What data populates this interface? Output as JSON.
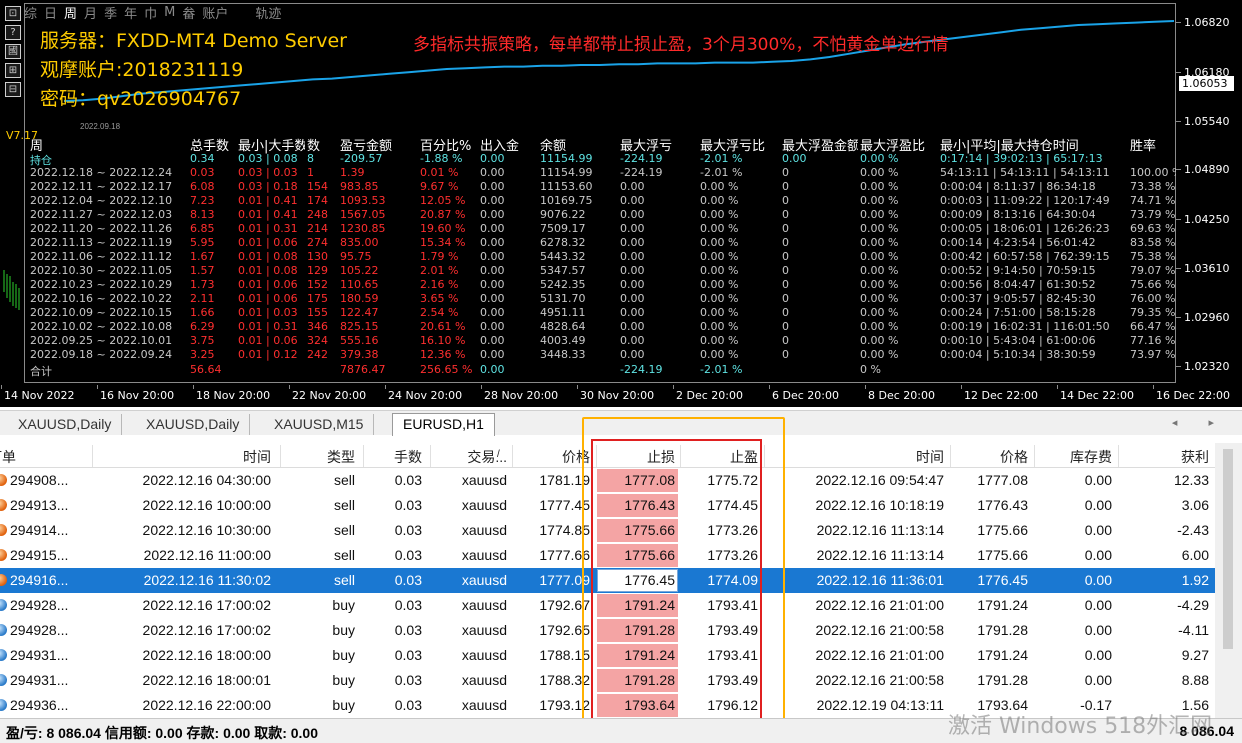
{
  "period_bar": [
    {
      "label": "综",
      "active": false
    },
    {
      "label": "日",
      "active": false
    },
    {
      "label": "周",
      "active": true
    },
    {
      "label": "月",
      "active": false
    },
    {
      "label": "季",
      "active": false
    },
    {
      "label": "年",
      "active": false
    },
    {
      "label": "巾",
      "active": false
    },
    {
      "label": "M",
      "active": false
    },
    {
      "label": "畚",
      "active": false
    },
    {
      "label": "账户",
      "active": false
    },
    {
      "label": "轨迹",
      "active": false,
      "wide": true
    }
  ],
  "left_tools": [
    "⊡",
    "?",
    "國",
    "⊞",
    "⊟"
  ],
  "left_vertical": "V7.17",
  "info": {
    "server": "服务器：FXDD-MT4 Demo Server",
    "account": "观摩账户:2018231119",
    "password": "密码：qv2026904767"
  },
  "headline": "多指标共振策略，每单都带止损止盈，3个月300%，不怕黄金单边行情",
  "start_date": "2022.09.18",
  "equity_curve": [
    0.0,
    0.01,
    0.03,
    0.06,
    0.09,
    0.11,
    0.13,
    0.15,
    0.17,
    0.19,
    0.21,
    0.23,
    0.25,
    0.27,
    0.28,
    0.3,
    0.32,
    0.34,
    0.36,
    0.38,
    0.4,
    0.41,
    0.42,
    0.43,
    0.43,
    0.44,
    0.44,
    0.45,
    0.45,
    0.46,
    0.46,
    0.47,
    0.47,
    0.47,
    0.48,
    0.48,
    0.48,
    0.49,
    0.5,
    0.52,
    0.55,
    0.59,
    0.63,
    0.67,
    0.71,
    0.74,
    0.77,
    0.8,
    0.83,
    0.86,
    0.89,
    0.91,
    0.93,
    0.95,
    0.96,
    0.97,
    0.98,
    0.99,
    1.0
  ],
  "stats": {
    "headers": [
      "周",
      "总手数",
      "最小|大手数",
      "数",
      "盈亏金额",
      "百分比%",
      "出入金",
      "余额",
      "最大浮亏",
      "最大浮亏比",
      "最大浮盈金额",
      "最大浮盈比",
      "最小|平均|最大持仓时间",
      "胜率"
    ],
    "holding": [
      "持仓",
      "0.34",
      "0.03 | 0.08",
      "8",
      "-209.57",
      "-1.88 %",
      "0.00",
      "11154.99",
      "-224.19",
      "-2.01 %",
      "0.00",
      "0.00 %",
      "0:17:14 | 39:02:13 | 65:17:13",
      ""
    ],
    "weeks": [
      [
        "2022.12.18 ~ 2022.12.24",
        "0.03",
        "0.03 | 0.03",
        "1",
        "1.39",
        "0.01 %",
        "0.00",
        "11154.99",
        "-224.19",
        "-2.01 %",
        "0",
        "0.00 %",
        "54:13:11 | 54:13:11 | 54:13:11",
        "100.00 %"
      ],
      [
        "2022.12.11 ~ 2022.12.17",
        "6.08",
        "0.03 | 0.18",
        "154",
        "983.85",
        "9.67 %",
        "0.00",
        "11153.60",
        "0.00",
        "0.00 %",
        "0",
        "0.00 %",
        "0:00:04 | 8:11:37 | 86:34:18",
        "73.38 %"
      ],
      [
        "2022.12.04 ~ 2022.12.10",
        "7.23",
        "0.01 | 0.41",
        "174",
        "1093.53",
        "12.05 %",
        "0.00",
        "10169.75",
        "0.00",
        "0.00 %",
        "0",
        "0.00 %",
        "0:00:03 | 11:09:22 | 120:17:49",
        "74.71 %"
      ],
      [
        "2022.11.27 ~ 2022.12.03",
        "8.13",
        "0.01 | 0.41",
        "248",
        "1567.05",
        "20.87 %",
        "0.00",
        "9076.22",
        "0.00",
        "0.00 %",
        "0",
        "0.00 %",
        "0:00:09 | 8:13:16 | 64:30:04",
        "73.79 %"
      ],
      [
        "2022.11.20 ~ 2022.11.26",
        "6.85",
        "0.01 | 0.31",
        "214",
        "1230.85",
        "19.60 %",
        "0.00",
        "7509.17",
        "0.00",
        "0.00 %",
        "0",
        "0.00 %",
        "0:00:05 | 18:06:01 | 126:26:23",
        "69.63 %"
      ],
      [
        "2022.11.13 ~ 2022.11.19",
        "5.95",
        "0.01 | 0.06",
        "274",
        "835.00",
        "15.34 %",
        "0.00",
        "6278.32",
        "0.00",
        "0.00 %",
        "0",
        "0.00 %",
        "0:00:14 | 4:23:54 | 56:01:42",
        "83.58 %"
      ],
      [
        "2022.11.06 ~ 2022.11.12",
        "1.67",
        "0.01 | 0.08",
        "130",
        "95.75",
        "1.79 %",
        "0.00",
        "5443.32",
        "0.00",
        "0.00 %",
        "0",
        "0.00 %",
        "0:00:42 | 60:57:58 | 762:39:15",
        "75.38 %"
      ],
      [
        "2022.10.30 ~ 2022.11.05",
        "1.57",
        "0.01 | 0.08",
        "129",
        "105.22",
        "2.01 %",
        "0.00",
        "5347.57",
        "0.00",
        "0.00 %",
        "0",
        "0.00 %",
        "0:00:52 | 9:14:50 | 70:59:15",
        "79.07 %"
      ],
      [
        "2022.10.23 ~ 2022.10.29",
        "1.73",
        "0.01 | 0.06",
        "152",
        "110.65",
        "2.16 %",
        "0.00",
        "5242.35",
        "0.00",
        "0.00 %",
        "0",
        "0.00 %",
        "0:00:56 | 8:04:47 | 61:30:52",
        "75.66 %"
      ],
      [
        "2022.10.16 ~ 2022.10.22",
        "2.11",
        "0.01 | 0.06",
        "175",
        "180.59",
        "3.65 %",
        "0.00",
        "5131.70",
        "0.00",
        "0.00 %",
        "0",
        "0.00 %",
        "0:00:37 | 9:05:57 | 82:45:30",
        "76.00 %"
      ],
      [
        "2022.10.09 ~ 2022.10.15",
        "1.66",
        "0.01 | 0.03",
        "155",
        "122.47",
        "2.54 %",
        "0.00",
        "4951.11",
        "0.00",
        "0.00 %",
        "0",
        "0.00 %",
        "0:00:24 | 7:51:00 | 58:15:28",
        "79.35 %"
      ],
      [
        "2022.10.02 ~ 2022.10.08",
        "6.29",
        "0.01 | 0.31",
        "346",
        "825.15",
        "20.61 %",
        "0.00",
        "4828.64",
        "0.00",
        "0.00 %",
        "0",
        "0.00 %",
        "0:00:19 | 16:02:31 | 116:01:50",
        "66.47 %"
      ],
      [
        "2022.09.25 ~ 2022.10.01",
        "3.75",
        "0.01 | 0.06",
        "324",
        "555.16",
        "16.10 %",
        "0.00",
        "4003.49",
        "0.00",
        "0.00 %",
        "0",
        "0.00 %",
        "0:00:10 | 5:43:04 | 61:00:06",
        "77.16 %"
      ],
      [
        "2022.09.18 ~ 2022.09.24",
        "3.25",
        "0.01 | 0.12",
        "242",
        "379.38",
        "12.36 %",
        "0.00",
        "3448.33",
        "0.00",
        "0.00 %",
        "0",
        "0.00 %",
        "0:00:04 | 5:10:34 | 38:30:59",
        "73.97 %"
      ]
    ],
    "total": [
      "合计",
      "56.64",
      "",
      "",
      "7876.47",
      "256.65 %",
      "0.00",
      "",
      "-224.19",
      "-2.01 %",
      "",
      "0 %",
      "",
      ""
    ]
  },
  "price_axis": [
    "1.06820",
    "1.06180",
    "1.05540",
    "1.04890",
    "1.04250",
    "1.03610",
    "1.02960",
    "1.02320"
  ],
  "current_price": "1.06053",
  "time_axis": [
    "14 Nov 2022",
    "16 Nov 20:00",
    "18 Nov 20:00",
    "22 Nov 20:00",
    "24 Nov 20:00",
    "28 Nov 20:00",
    "30 Nov 20:00",
    "2 Dec 20:00",
    "6 Dec 20:00",
    "8 Dec 20:00",
    "12 Dec 22:00",
    "14 Dec 22:00",
    "16 Dec 22:00"
  ],
  "tabs": [
    {
      "label": "XAUUSD,Daily",
      "active": false
    },
    {
      "label": "XAUUSD,Daily",
      "active": false
    },
    {
      "label": "XAUUSD,M15",
      "active": false
    },
    {
      "label": "EURUSD,H1",
      "active": true
    }
  ],
  "tab_arrows": "◂ ▸",
  "grid": {
    "headers": [
      "订单",
      "时间",
      "类型",
      "手数",
      "交易...",
      "价格",
      "止损",
      "止盈",
      "时间",
      "价格",
      "库存费",
      "获利"
    ],
    "sort_mark": "/",
    "rows": [
      {
        "type_icon": "sell",
        "cells": [
          "294908...",
          "2022.12.16 04:30:00",
          "sell",
          "0.03",
          "xauusd",
          "1781.19",
          "1777.08",
          "1775.72",
          "2022.12.16 09:54:47",
          "1777.08",
          "0.00",
          "12.33"
        ]
      },
      {
        "type_icon": "sell",
        "cells": [
          "294913...",
          "2022.12.16 10:00:00",
          "sell",
          "0.03",
          "xauusd",
          "1777.45",
          "1776.43",
          "1774.45",
          "2022.12.16 10:18:19",
          "1776.43",
          "0.00",
          "3.06"
        ]
      },
      {
        "type_icon": "sell",
        "cells": [
          "294914...",
          "2022.12.16 10:30:00",
          "sell",
          "0.03",
          "xauusd",
          "1774.85",
          "1775.66",
          "1773.26",
          "2022.12.16 11:13:14",
          "1775.66",
          "0.00",
          "-2.43"
        ]
      },
      {
        "type_icon": "sell",
        "cells": [
          "294915...",
          "2022.12.16 11:00:00",
          "sell",
          "0.03",
          "xauusd",
          "1777.66",
          "1775.66",
          "1773.26",
          "2022.12.16 11:13:14",
          "1775.66",
          "0.00",
          "6.00"
        ]
      },
      {
        "type_icon": "sell",
        "selected": true,
        "cells": [
          "294916...",
          "2022.12.16 11:30:02",
          "sell",
          "0.03",
          "xauusd",
          "1777.09",
          "1776.45",
          "1774.09",
          "2022.12.16 11:36:01",
          "1776.45",
          "0.00",
          "1.92"
        ]
      },
      {
        "type_icon": "buy",
        "cells": [
          "294928...",
          "2022.12.16 17:00:02",
          "buy",
          "0.03",
          "xauusd",
          "1792.67",
          "1791.24",
          "1793.41",
          "2022.12.16 21:01:00",
          "1791.24",
          "0.00",
          "-4.29"
        ]
      },
      {
        "type_icon": "buy",
        "cells": [
          "294928...",
          "2022.12.16 17:00:02",
          "buy",
          "0.03",
          "xauusd",
          "1792.65",
          "1791.28",
          "1793.49",
          "2022.12.16 21:00:58",
          "1791.28",
          "0.00",
          "-4.11"
        ]
      },
      {
        "type_icon": "buy",
        "cells": [
          "294931...",
          "2022.12.16 18:00:00",
          "buy",
          "0.03",
          "xauusd",
          "1788.15",
          "1791.24",
          "1793.41",
          "2022.12.16 21:01:00",
          "1791.24",
          "0.00",
          "9.27"
        ]
      },
      {
        "type_icon": "buy",
        "cells": [
          "294931...",
          "2022.12.16 18:00:01",
          "buy",
          "0.03",
          "xauusd",
          "1788.32",
          "1791.28",
          "1793.49",
          "2022.12.16 21:00:58",
          "1791.28",
          "0.00",
          "8.88"
        ]
      },
      {
        "type_icon": "buy",
        "cells": [
          "294936...",
          "2022.12.16 22:00:00",
          "buy",
          "0.03",
          "xauusd",
          "1793.12",
          "1793.64",
          "1796.12",
          "2022.12.19 04:13:11",
          "1793.64",
          "-0.17",
          "1.56"
        ]
      }
    ]
  },
  "status": {
    "text": "盈/亏: 8 086.04  信用额: 0.00  存款: 0.00  取款: 0.00",
    "total": "8 086.04"
  },
  "watermark": "激活 Windows  518外汇网",
  "colors": {
    "equity_line": "#1aa3e8",
    "holding": "#5fe3e3",
    "loss_red": "#ff2f2f",
    "selection": "#1a78d2",
    "stoploss_fill": "#f4a4a4",
    "highlight_orange": "#ffb100",
    "highlight_red": "#e02020"
  }
}
